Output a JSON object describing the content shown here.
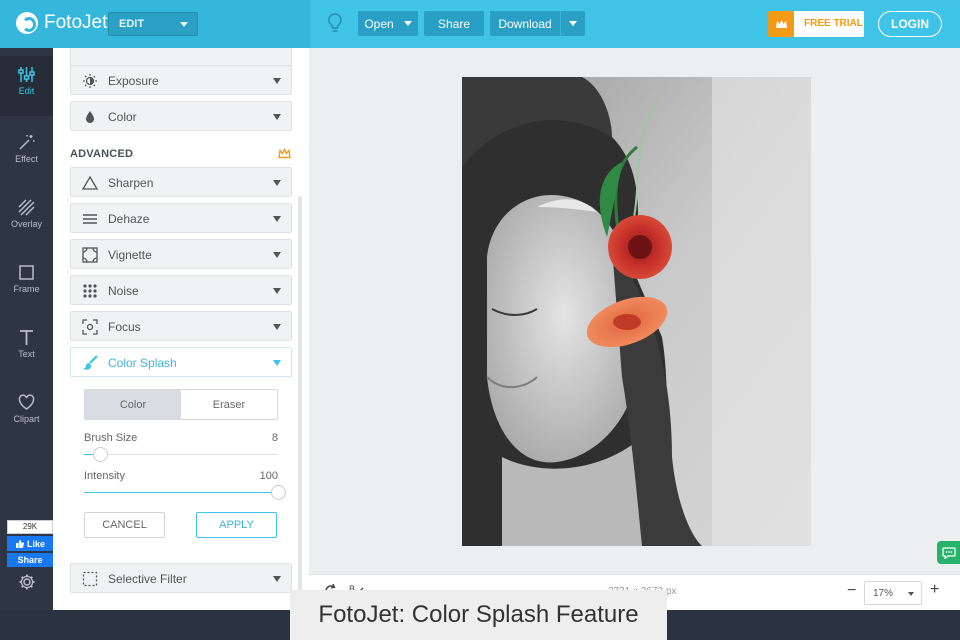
{
  "app": {
    "name": "FotoJet",
    "mode": "EDIT"
  },
  "toolbar": {
    "open": "Open",
    "share": "Share",
    "download": "Download",
    "free_trial": "FREE TRIAL",
    "login": "LOGIN"
  },
  "nav": [
    {
      "label": "Edit"
    },
    {
      "label": "Effect"
    },
    {
      "label": "Overlay"
    },
    {
      "label": "Frame"
    },
    {
      "label": "Text"
    },
    {
      "label": "Clipart"
    }
  ],
  "social": {
    "count": "29K",
    "like": "Like",
    "share": "Share"
  },
  "panel": {
    "basic": [
      {
        "label": "Exposure"
      },
      {
        "label": "Color"
      }
    ],
    "advanced_title": "ADVANCED",
    "advanced": [
      {
        "label": "Sharpen"
      },
      {
        "label": "Dehaze"
      },
      {
        "label": "Vignette"
      },
      {
        "label": "Noise"
      },
      {
        "label": "Focus"
      },
      {
        "label": "Color Splash"
      }
    ],
    "splash": {
      "tab_color": "Color",
      "tab_eraser": "Eraser",
      "brush_size_label": "Brush Size",
      "brush_size": 8,
      "brush_size_max": 100,
      "intensity_label": "Intensity",
      "intensity": 100,
      "intensity_max": 100,
      "cancel": "CANCEL",
      "apply": "APPLY"
    },
    "selective_filter": "Selective Filter"
  },
  "status": {
    "dims": "2731 x 3673 px",
    "zoom": "17%",
    "zoom_minus": "−",
    "zoom_plus": "+"
  },
  "caption": "FotoJet: Color Splash Feature",
  "colors": {
    "accent": "#3fc3e6",
    "trial": "#f39a16",
    "nav_bg": "#2e3543"
  }
}
